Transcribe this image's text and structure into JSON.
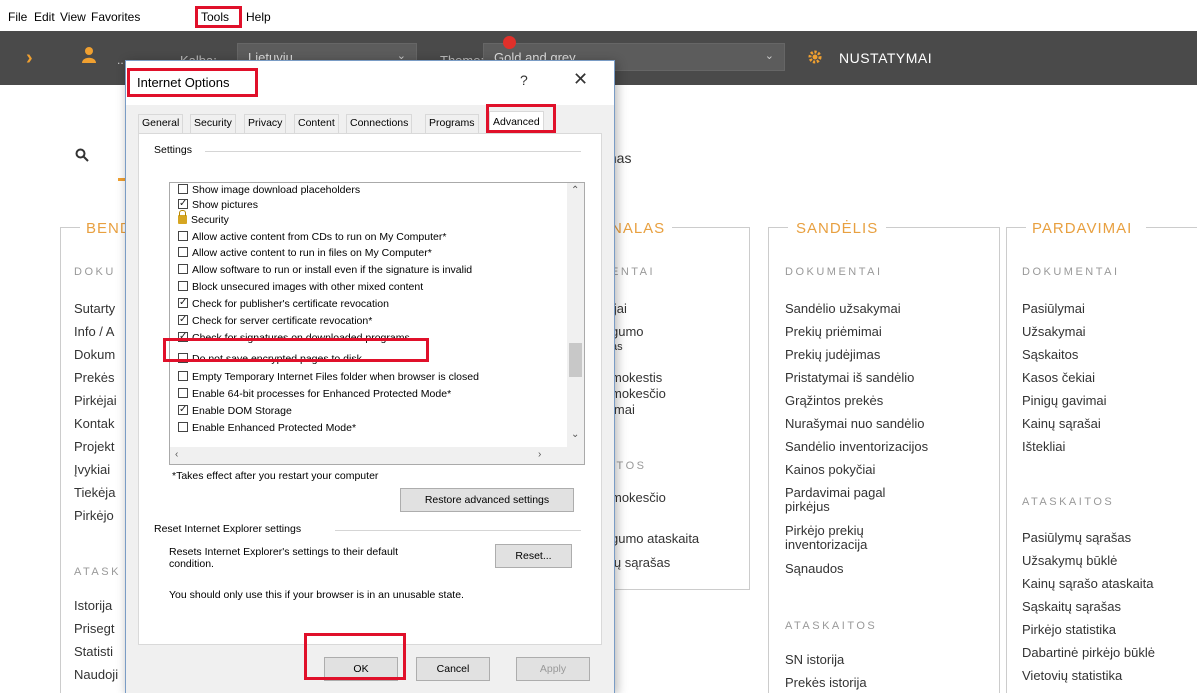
{
  "menubar": {
    "items": [
      "File",
      "Edit",
      "View",
      "Favorites",
      "Tools",
      "Help"
    ]
  },
  "appbar": {
    "user_name": "..",
    "language_label": "Kalba:",
    "language_value": "Lietuvių",
    "theme_label": "Theme:",
    "theme_value": "Gold and grey",
    "settings_label": "NUSTATYMAI"
  },
  "body": {
    "tab_partial": "I",
    "tab_text": "mas"
  },
  "sections": {
    "bendra": {
      "title": "BEND",
      "sub1": "DOKU",
      "items1": [
        "Sutarty",
        "Info / A",
        "Dokum",
        "Prekės",
        "Pirkėjai",
        "Kontak",
        "Projekt",
        "Įvykiai",
        "Tiekėja",
        "Pirkėjo"
      ],
      "sub2": "ATASK",
      "items2": [
        "Istorija",
        "Prisegt",
        "Statisti",
        "Naudoji"
      ]
    },
    "middle": {
      "title": "NALAS",
      "sub1": "ENTAI",
      "items1": [
        "ijai",
        "gumo",
        "as",
        "mokestis",
        "mokesčio",
        "imai"
      ],
      "sub2": "ITOS",
      "items2": [
        "mokesčio",
        "gumo ataskaita",
        "ių sąrašas"
      ]
    },
    "sandelis": {
      "title": "SANDĖLIS",
      "sub1": "DOKUMENTAI",
      "items1": [
        "Sandėlio užsakymai",
        "Prekių priėmimai",
        "Prekių judėjimas",
        "Pristatymai iš sandėlio",
        "Grąžintos prekės",
        "Nurašymai nuo sandėlio",
        "Sandėlio inventorizacijos",
        "Kainos pokyčiai",
        "Pardavimai pagal",
        "pirkėjus",
        "Pirkėjo prekių",
        "inventorizacija",
        "Sąnaudos"
      ],
      "sub2": "ATASKAITOS",
      "items2": [
        "SN istorija",
        "Prekės istorija"
      ]
    },
    "pardavimai": {
      "title": "PARDAVIMAI",
      "sub1": "DOKUMENTAI",
      "items1": [
        "Pasiūlymai",
        "Užsakymai",
        "Sąskaitos",
        "Kasos čekiai",
        "Pinigų gavimai",
        "Kainų sąrašai",
        "Ištekliai"
      ],
      "sub2": "ATASKAITOS",
      "items2": [
        "Pasiūlymų sąrašas",
        "Užsakymų būklė",
        "Kainų sąrašo ataskaita",
        "Sąskaitų sąrašas",
        "Pirkėjo statistika",
        "Dabartinė pirkėjo būklė",
        "Vietovių statistika"
      ]
    }
  },
  "dialog": {
    "title": "Internet Options",
    "help": "?",
    "close": "✕",
    "tabs": [
      "General",
      "Security",
      "Privacy",
      "Content",
      "Connections",
      "Programs",
      "Advanced"
    ],
    "settings_label": "Settings",
    "rows": [
      {
        "text": "Show image download placeholders",
        "checked": false
      },
      {
        "text": "Show pictures",
        "checked": true
      },
      {
        "text": "Security",
        "group": true
      },
      {
        "text": "Allow active content from CDs to run on My Computer*",
        "checked": false
      },
      {
        "text": "Allow active content to run in files on My Computer*",
        "checked": false
      },
      {
        "text": "Allow software to run or install even if the signature is invalid",
        "checked": false
      },
      {
        "text": "Block unsecured images with other mixed content",
        "checked": false
      },
      {
        "text": "Check for publisher's certificate revocation",
        "checked": true
      },
      {
        "text": "Check for server certificate revocation*",
        "checked": true
      },
      {
        "text": "Check for signatures on downloaded programs",
        "checked": true
      },
      {
        "text": "Do not save encrypted pages to disk",
        "checked": false
      },
      {
        "text": "Empty Temporary Internet Files folder when browser is closed",
        "checked": false
      },
      {
        "text": "Enable 64-bit processes for Enhanced Protected Mode*",
        "checked": false
      },
      {
        "text": "Enable DOM Storage",
        "checked": true
      },
      {
        "text": "Enable Enhanced Protected Mode*",
        "checked": false
      }
    ],
    "restart_note": "*Takes effect after you restart your computer",
    "restore_button": "Restore advanced settings",
    "reset_group_label": "Reset Internet Explorer settings",
    "reset_desc_line1": "Resets Internet Explorer's settings to their default",
    "reset_desc_line2": "condition.",
    "reset_button": "Reset...",
    "reset_warning": "You should only use this if your browser is in an unusable state.",
    "ok_button": "OK",
    "cancel_button": "Cancel",
    "apply_button": "Apply"
  },
  "colors": {
    "highlight": "#e0102a",
    "accent": "#f0a030",
    "header_bg": "#4a4a4a"
  }
}
